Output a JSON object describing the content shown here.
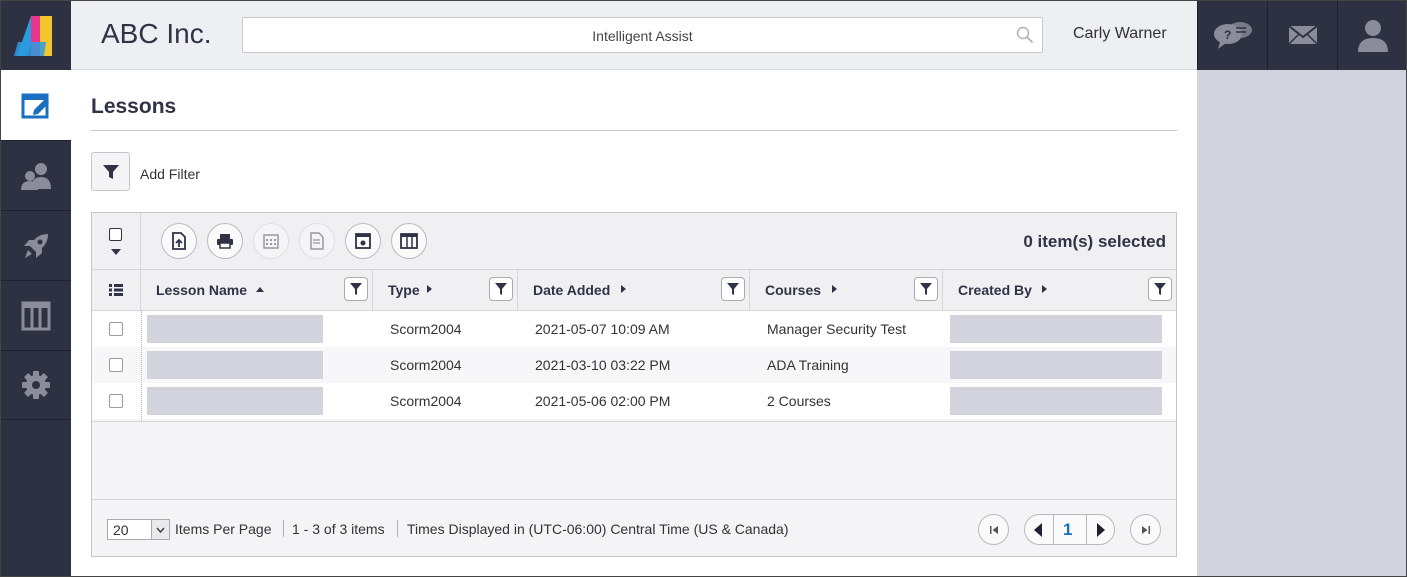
{
  "header": {
    "company": "ABC Inc.",
    "search_placeholder": "Intelligent Assist",
    "user_name": "Carly Warner"
  },
  "sidebar": {
    "items": [
      {
        "icon": "lesson-edit-icon",
        "active": true
      },
      {
        "icon": "users-icon",
        "active": false
      },
      {
        "icon": "rocket-icon",
        "active": false
      },
      {
        "icon": "columns-icon",
        "active": false
      },
      {
        "icon": "gear-icon",
        "active": false
      }
    ]
  },
  "top_right_icons": [
    "help-chat-icon",
    "mail-icon",
    "profile-icon"
  ],
  "page": {
    "title": "Lessons",
    "add_filter_label": "Add Filter"
  },
  "grid": {
    "selected_text": "0 item(s) selected",
    "toolbar_buttons": [
      {
        "icon": "export-icon",
        "enabled": true
      },
      {
        "icon": "print-icon",
        "enabled": true
      },
      {
        "icon": "calendar-icon",
        "enabled": false
      },
      {
        "icon": "document-icon",
        "enabled": false
      },
      {
        "icon": "settings-window-icon",
        "enabled": true
      },
      {
        "icon": "columns-icon",
        "enabled": true
      }
    ],
    "columns": [
      {
        "label": "Lesson Name",
        "sort": "asc"
      },
      {
        "label": "Type",
        "sort": "none"
      },
      {
        "label": "Date Added",
        "sort": "none"
      },
      {
        "label": "Courses",
        "sort": "none"
      },
      {
        "label": "Created By",
        "sort": "none"
      }
    ],
    "rows": [
      {
        "lesson_name": "",
        "type": "Scorm2004",
        "date_added": "2021-05-07 10:09 AM",
        "courses": "Manager Security Test",
        "created_by": ""
      },
      {
        "lesson_name": "",
        "type": "Scorm2004",
        "date_added": "2021-03-10 03:22 PM",
        "courses": "ADA Training",
        "created_by": ""
      },
      {
        "lesson_name": "",
        "type": "Scorm2004",
        "date_added": "2021-05-06 02:00 PM",
        "courses": "2 Courses",
        "created_by": ""
      }
    ],
    "footer": {
      "page_size": "20",
      "items_per_page_label": "Items Per Page",
      "range_text": "1 - 3 of 3 items",
      "timezone_text": "Times Displayed in (UTC-06:00) Central Time (US & Canada)",
      "current_page": "1"
    }
  },
  "colors": {
    "sidebar_bg": "#2e3142",
    "header_bg": "#eeeff3",
    "right_panel_bg": "#d2d3dc",
    "accent_blue": "#1a6fc0",
    "redaction": "#d2d3dc"
  }
}
